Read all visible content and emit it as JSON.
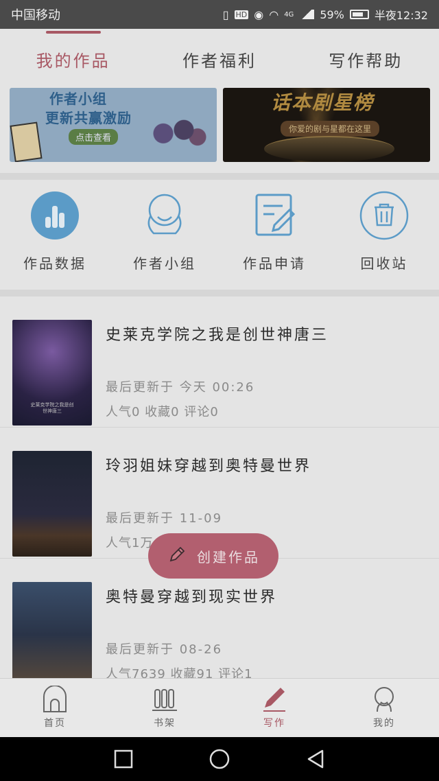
{
  "status_bar": {
    "carrier": "中国移动",
    "hd": "HD",
    "net": "4G",
    "battery": "59%",
    "time": "半夜12:32"
  },
  "top_tabs": [
    {
      "label": "我的作品",
      "active": true
    },
    {
      "label": "作者福利",
      "active": false
    },
    {
      "label": "写作帮助",
      "active": false
    }
  ],
  "banners": [
    {
      "line1": "作者小组",
      "line2": "更新共赢激励",
      "button": "点击查看"
    },
    {
      "title": "话本剧星榜",
      "subtitle": "你爱的剧与星都在这里"
    }
  ],
  "shortcuts": [
    {
      "label": "作品数据",
      "icon": "bar-chart-icon"
    },
    {
      "label": "作者小组",
      "icon": "group-icon"
    },
    {
      "label": "作品申请",
      "icon": "edit-document-icon"
    },
    {
      "label": "回收站",
      "icon": "trash-icon"
    }
  ],
  "works": [
    {
      "title": "史莱克学院之我是创世神唐三",
      "updated": "最后更新于 今天 00:26",
      "stats": "人气0 收藏0 评论0",
      "cover_text": "史莱克学院之我是创世神唐三"
    },
    {
      "title": "玲羽姐妹穿越到奥特曼世界",
      "updated": "最后更新于 11-09",
      "stats": "人气1万"
    },
    {
      "title": "奥特曼穿越到现实世界",
      "updated": "最后更新于 08-26",
      "stats": "人气7639 收藏91 评论1"
    }
  ],
  "fab": {
    "label": "创建作品"
  },
  "bottom_tabs": [
    {
      "label": "首页",
      "icon": "home-icon",
      "active": false
    },
    {
      "label": "书架",
      "icon": "bookshelf-icon",
      "active": false
    },
    {
      "label": "写作",
      "icon": "pen-icon",
      "active": true
    },
    {
      "label": "我的",
      "icon": "profile-icon",
      "active": false
    }
  ],
  "colors": {
    "accent": "#a85864",
    "fab": "#b25f6f",
    "icon_blue": "#5b9bc7"
  }
}
